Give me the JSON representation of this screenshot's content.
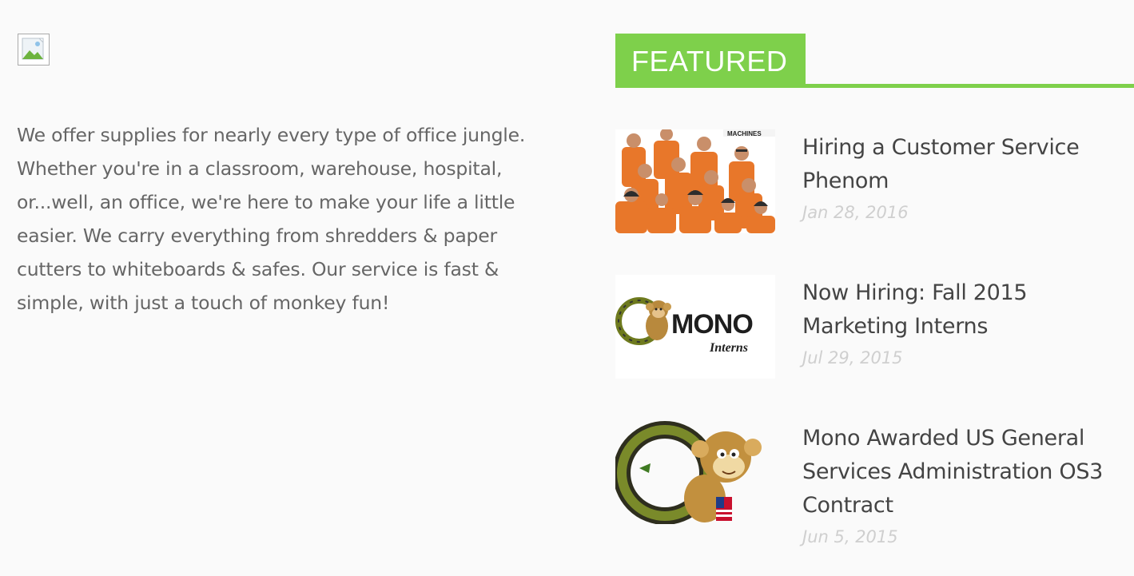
{
  "about": {
    "text": "We offer supplies for nearly every type of office jungle. Whether you're in a classroom, warehouse, hospital, or...well, an office, we're here to make your life a little easier. We carry everything from shredders & paper cutters to whiteboards & safes. Our service is fast & simple, with just a touch of monkey fun!"
  },
  "featured": {
    "heading": "FEATURED",
    "accent_color": "#7ed04b"
  },
  "posts": [
    {
      "title": "Hiring a Customer Service Phenom",
      "date": "Jan 28, 2016",
      "thumb_label": "MACHINES",
      "thumb_icon": "team-photo"
    },
    {
      "title": "Now Hiring: Fall 2015 Marketing Interns",
      "date": "Jul 29, 2015",
      "thumb_brand": "MONO",
      "thumb_sub": "Interns",
      "thumb_icon": "monkey-logo"
    },
    {
      "title": "Mono Awarded US General Services Administration OS3 Contract",
      "date": "Jun 5, 2015",
      "thumb_icon": "monkey-logo"
    }
  ]
}
